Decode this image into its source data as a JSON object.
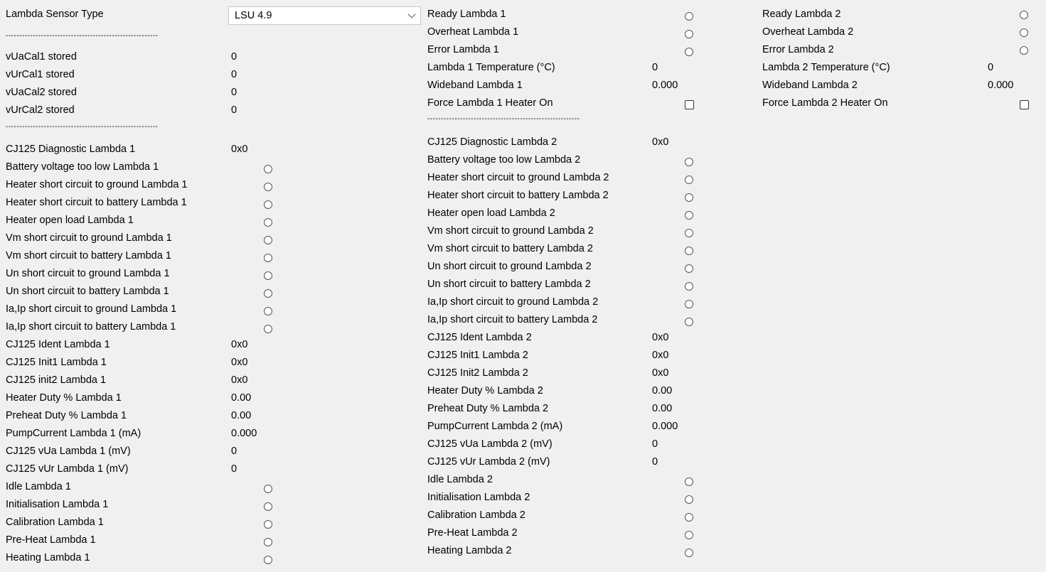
{
  "col1": {
    "sensor_type_label": "Lambda Sensor Type",
    "sensor_type_value": "LSU 4.9",
    "separator": "--------------------------------------------------------",
    "stored": [
      {
        "label": "vUaCal1 stored",
        "value": "0"
      },
      {
        "label": "vUrCal1 stored",
        "value": "0"
      },
      {
        "label": "vUaCal2 stored",
        "value": "0"
      },
      {
        "label": "vUrCal2 stored",
        "value": "0"
      }
    ],
    "diag": [
      {
        "label": "CJ125 Diagnostic Lambda 1",
        "value": "0x0"
      },
      {
        "label": "Battery voltage too low Lambda 1"
      },
      {
        "label": "Heater short circuit to ground Lambda 1"
      },
      {
        "label": "Heater short circuit to battery Lambda 1"
      },
      {
        "label": "Heater open load Lambda 1"
      },
      {
        "label": "Vm short circuit to ground Lambda 1"
      },
      {
        "label": "Vm short circuit to battery Lambda 1"
      },
      {
        "label": "Un short circuit to ground Lambda 1"
      },
      {
        "label": "Un short circuit to battery Lambda 1"
      },
      {
        "label": "Ia,Ip short circuit to ground Lambda 1"
      },
      {
        "label": "Ia,Ip short circuit to battery Lambda 1"
      },
      {
        "label": "CJ125 Ident Lambda 1",
        "value": "0x0"
      },
      {
        "label": "CJ125 Init1 Lambda 1",
        "value": "0x0"
      },
      {
        "label": "CJ125 init2 Lambda 1",
        "value": "0x0"
      },
      {
        "label": "Heater Duty % Lambda 1",
        "value": "0.00"
      },
      {
        "label": "Preheat Duty % Lambda 1",
        "value": "0.00"
      },
      {
        "label": "PumpCurrent Lambda 1 (mA)",
        "value": "0.000"
      },
      {
        "label": "CJ125 vUa Lambda 1 (mV)",
        "value": "0"
      },
      {
        "label": "CJ125 vUr Lambda 1 (mV)",
        "value": "0"
      },
      {
        "label": "Idle Lambda 1"
      },
      {
        "label": "Initialisation Lambda 1"
      },
      {
        "label": "Calibration Lambda 1"
      },
      {
        "label": "Pre-Heat Lambda 1"
      },
      {
        "label": "Heating Lambda 1"
      }
    ]
  },
  "col2": {
    "top": [
      {
        "label": "Ready Lambda 1"
      },
      {
        "label": "Overheat Lambda 1"
      },
      {
        "label": "Error Lambda 1"
      },
      {
        "label": "Lambda 1 Temperature (°C)",
        "value": "0"
      },
      {
        "label": "Wideband Lambda 1",
        "value": "0.000"
      },
      {
        "label": "Force Lambda 1 Heater On"
      }
    ],
    "separator": "--------------------------------------------------------",
    "diag": [
      {
        "label": "CJ125 Diagnostic Lambda 2",
        "value": "0x0"
      },
      {
        "label": "Battery voltage too low Lambda 2"
      },
      {
        "label": "Heater short circuit to ground Lambda 2"
      },
      {
        "label": "Heater short circuit to battery Lambda 2"
      },
      {
        "label": "Heater open load Lambda 2"
      },
      {
        "label": "Vm short circuit to ground Lambda 2"
      },
      {
        "label": "Vm short circuit to battery Lambda 2"
      },
      {
        "label": "Un short circuit to ground Lambda 2"
      },
      {
        "label": "Un short circuit to battery Lambda 2"
      },
      {
        "label": "Ia,Ip short circuit to ground Lambda 2"
      },
      {
        "label": "Ia,Ip short circuit to battery Lambda 2"
      },
      {
        "label": "CJ125 Ident Lambda 2",
        "value": "0x0"
      },
      {
        "label": "CJ125 Init1 Lambda 2",
        "value": "0x0"
      },
      {
        "label": "CJ125 Init2 Lambda 2",
        "value": "0x0"
      },
      {
        "label": "Heater Duty % Lambda 2",
        "value": "0.00"
      },
      {
        "label": "Preheat Duty % Lambda 2",
        "value": "0.00"
      },
      {
        "label": "PumpCurrent Lambda 2 (mA)",
        "value": "0.000"
      },
      {
        "label": "CJ125 vUa Lambda 2 (mV)",
        "value": "0"
      },
      {
        "label": "CJ125 vUr Lambda 2 (mV)",
        "value": "0"
      },
      {
        "label": "Idle Lambda 2"
      },
      {
        "label": "Initialisation Lambda 2"
      },
      {
        "label": "Calibration Lambda 2"
      },
      {
        "label": "Pre-Heat Lambda 2"
      },
      {
        "label": "Heating Lambda 2"
      }
    ]
  },
  "col3": {
    "top": [
      {
        "label": "Ready Lambda 2"
      },
      {
        "label": "Overheat Lambda 2"
      },
      {
        "label": "Error Lambda 2"
      },
      {
        "label": "Lambda 2 Temperature (°C)",
        "value": "0"
      },
      {
        "label": "Wideband Lambda 2",
        "value": "0.000"
      },
      {
        "label": "Force Lambda 2 Heater On"
      }
    ]
  }
}
